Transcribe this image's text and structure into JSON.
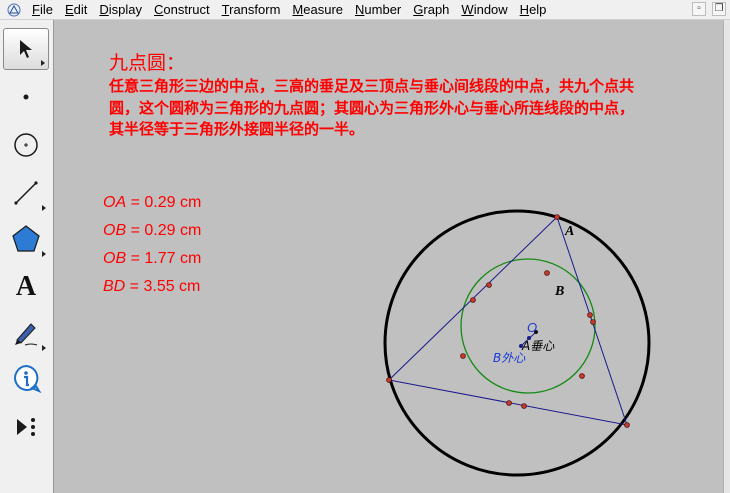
{
  "menu": [
    "File",
    "Edit",
    "Display",
    "Construct",
    "Transform",
    "Measure",
    "Number",
    "Graph",
    "Window",
    "Help"
  ],
  "window_controls": {
    "minimize": "▫",
    "restore": "❐"
  },
  "tools": {
    "text_tool_glyph": "A"
  },
  "content": {
    "title": "九点圆：",
    "description": "任意三角形三边的中点，三高的垂足及三顶点与垂心间线段的中点，共九个点共圆，这个圆称为三角形的九点圆；其圆心为三角形外心与垂心所连线段的中点，其半径等于三角形外接圆半径的一半。"
  },
  "measurements": [
    {
      "var": "OA",
      "value": " = 0.29 cm"
    },
    {
      "var": "OB",
      "value": " = 0.29 cm"
    },
    {
      "var": "OB",
      "value": " = 1.77 cm"
    },
    {
      "var": "BD",
      "value": " = 3.55 cm"
    }
  ],
  "labels": {
    "A_vertex": "A",
    "B_label": "B",
    "O_label": "O",
    "orthocenter": "A垂心",
    "circumcenter": "B外心"
  },
  "colors": {
    "text_red": "#ff0000",
    "triangle": "#1a1a8c",
    "nine_point_circle": "#138a13",
    "circumcircle": "#000000",
    "point_fill": "#c0392b",
    "label_blue": "#1a3ad6"
  }
}
